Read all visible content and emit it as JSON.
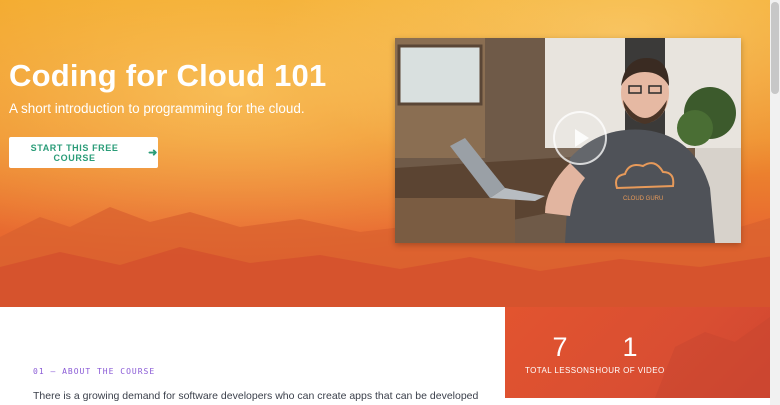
{
  "hero": {
    "title": "Coding for Cloud 101",
    "subtitle": "A short introduction to programming for the cloud.",
    "cta_label": "START THIS FREE COURSE",
    "cta_icon": "arrow-right-icon"
  },
  "video": {
    "shirt_text": "CLOUD GURU",
    "play_icon": "play-icon"
  },
  "stats": [
    {
      "value": "7",
      "label": "TOTAL LESSONS"
    },
    {
      "value": "1",
      "label": "HOUR OF VIDEO"
    }
  ],
  "about": {
    "section_label": "01 — ABOUT THE COURSE",
    "text": "There is a growing demand for software developers who can create apps that can be developed"
  },
  "colors": {
    "accent_green": "#2a9c78",
    "section_purple": "#8a5bd6",
    "hero_orange": "#ee8e2c",
    "stats_red": "#d94e32"
  }
}
